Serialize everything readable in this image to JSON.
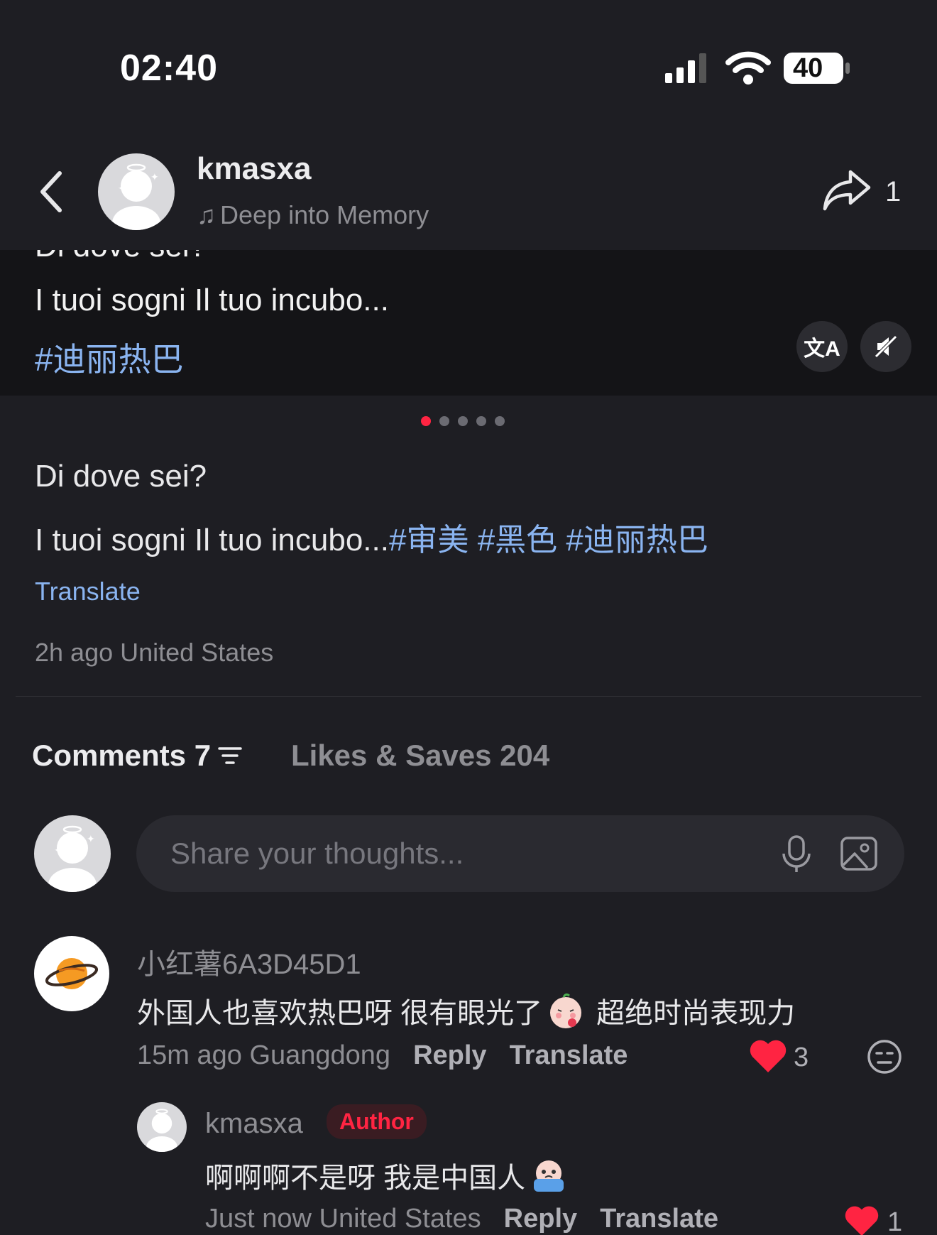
{
  "status": {
    "time": "02:40",
    "battery": "40"
  },
  "header": {
    "username": "kmasxa",
    "music": "Deep into Memory",
    "share_count": "1"
  },
  "overlay": {
    "line0": "Di dove sei?",
    "line1": "I tuoi sogni Il tuo incubo...",
    "hashtag": "#迪丽热巴",
    "translate_btn": "文A",
    "mute_btn": "◁"
  },
  "carousel": {
    "total": 5,
    "active": 0
  },
  "post": {
    "line1": "Di dove sei?",
    "line2_text": "I tuoi sogni Il tuo incubo...",
    "tags": [
      "#审美",
      "#黑色",
      "#迪丽热巴"
    ],
    "translate": "Translate",
    "meta": "2h ago United States"
  },
  "tabs": {
    "comments": "Comments 7",
    "likes": "Likes & Saves 204"
  },
  "input": {
    "placeholder": "Share your thoughts..."
  },
  "comments": [
    {
      "name": "小红薯6A3D45D1",
      "text_before": "外国人也喜欢热巴呀 很有眼光了",
      "text_after": "超绝时尚表现力",
      "time_location": "15m ago Guangdong",
      "reply": "Reply",
      "translate": "Translate",
      "likes": "3"
    }
  ],
  "reply": {
    "name": "kmasxa",
    "badge": "Author",
    "text": "啊啊啊不是呀 我是中国人",
    "time_location": "Just now United States",
    "reply": "Reply",
    "translate": "Translate",
    "likes": "1"
  },
  "colors": {
    "accent": "#ff2442",
    "link": "#8ab4f0",
    "background": "#1e1e23"
  }
}
